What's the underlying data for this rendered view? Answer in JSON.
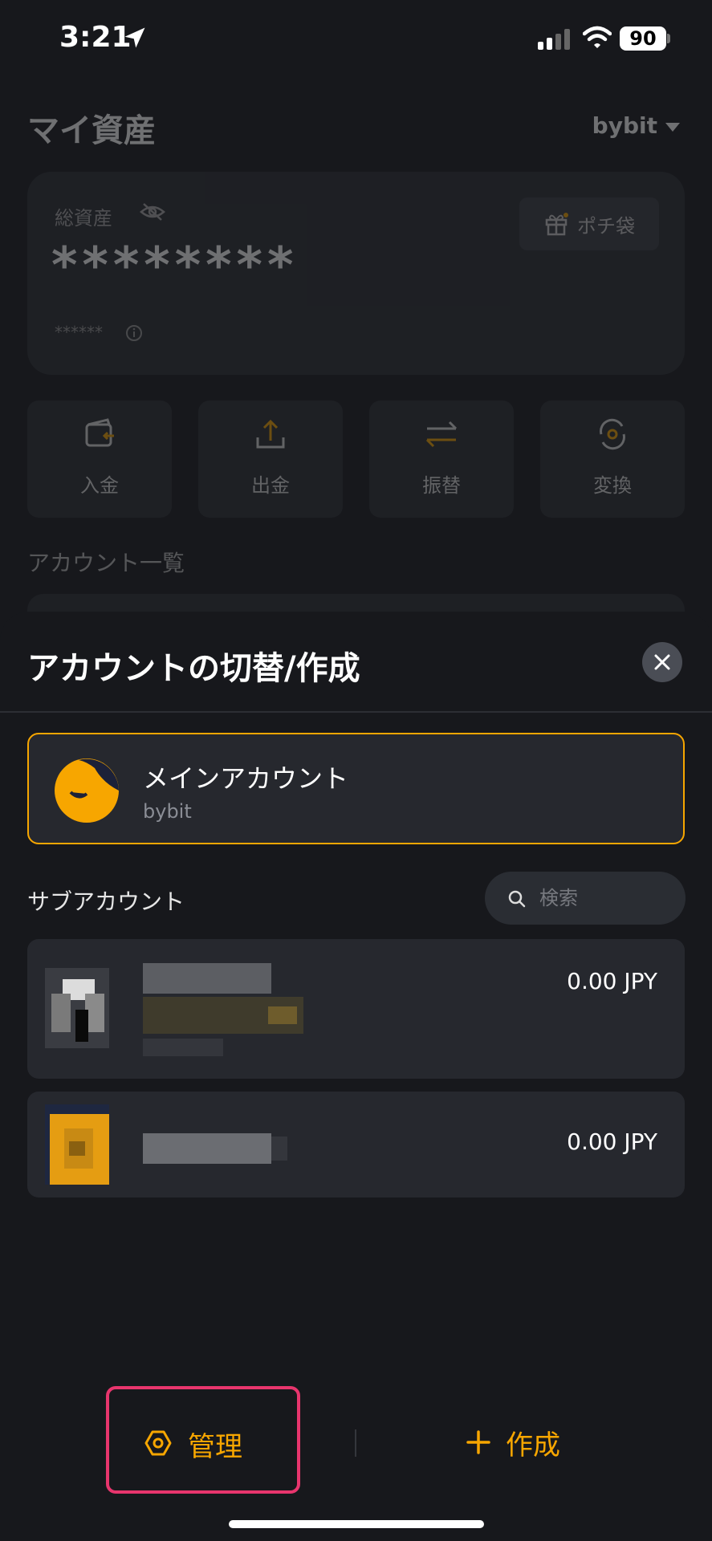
{
  "status_bar": {
    "time": "3:21",
    "battery": "90"
  },
  "background": {
    "page_title": "マイ資産",
    "exchange": "bybit",
    "total_assets_label": "総資産",
    "total_assets_value": "********",
    "total_assets_sub": "******",
    "pochi_label": "ポチ袋",
    "actions": [
      "入金",
      "出金",
      "振替",
      "変換"
    ],
    "account_list_title": "アカウント一覧"
  },
  "sheet": {
    "title": "アカウントの切替/作成",
    "main_account": {
      "name": "メインアカウント",
      "exchange": "bybit"
    },
    "sub_accounts_title": "サブアカウント",
    "search_placeholder": "検索",
    "sub_accounts": [
      {
        "balance": "0.00 JPY"
      },
      {
        "balance": "0.00 JPY"
      }
    ],
    "manage_label": "管理",
    "create_label": "作成"
  },
  "colors": {
    "accent": "#f7a600",
    "highlight": "#e8356d",
    "background": "#17181c",
    "card": "#26282e"
  },
  "icons": [
    "location-arrow-icon",
    "signal-icon",
    "wifi-icon",
    "eye-off-icon",
    "info-icon",
    "gift-icon",
    "deposit-icon",
    "withdraw-icon",
    "transfer-icon",
    "convert-icon",
    "close-icon",
    "search-icon",
    "settings-hex-icon",
    "plus-icon"
  ]
}
